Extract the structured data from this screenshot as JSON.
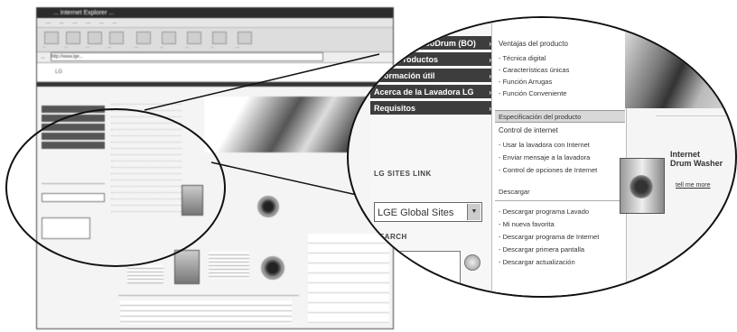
{
  "small_screenshot": {
    "title": "... Internet Explorer ...",
    "menu": [
      "...",
      "...",
      "...",
      "...",
      "...",
      "..."
    ],
    "toolbar": [
      "...",
      "...",
      "...",
      "...",
      "...",
      "...",
      "...",
      "...",
      "..."
    ],
    "address_label": "...",
    "address_value": "http://www.lge...",
    "logo_text": "LG"
  },
  "zoom": {
    "nav_items": [
      {
        "label": "Lavadora TurboDrum (BO)",
        "arrow": "›"
      },
      {
        "label": "Otros Productos",
        "arrow": "›"
      },
      {
        "label": "Información útil",
        "arrow": "›"
      },
      {
        "label": "Acerca de la Lavadora LG",
        "arrow": "›"
      },
      {
        "label": "Requisitos",
        "arrow": "›"
      }
    ],
    "submenu": {
      "section1_title": "Ventajas del producto",
      "section1_items": [
        "- Técnica digital",
        "- Características únicas",
        "- Función Arrugas",
        "- Función Conveniente"
      ],
      "spec_header": "Especificación del producto",
      "section2_title": "Control de internet",
      "section2_items": [
        "- Usar la lavadora con Internet",
        "- Enviar mensaje a la lavadora",
        "- Control de opciones de Internet"
      ],
      "download_header": "Descargar",
      "section3_items": [
        "- Descargar programa Lavado",
        "- Mi nueva favorita",
        "- Descargar programa de Internet",
        "- Descargar primera pantalla",
        "- Descargar actualización"
      ]
    },
    "sites_header": "LG SITES LINK",
    "sites_select": "LGE Global Sites",
    "search_header": "SEARCH",
    "promo_title_1": "Internet",
    "promo_title_2": "Drum Washer",
    "promo_link": "tell me more"
  }
}
